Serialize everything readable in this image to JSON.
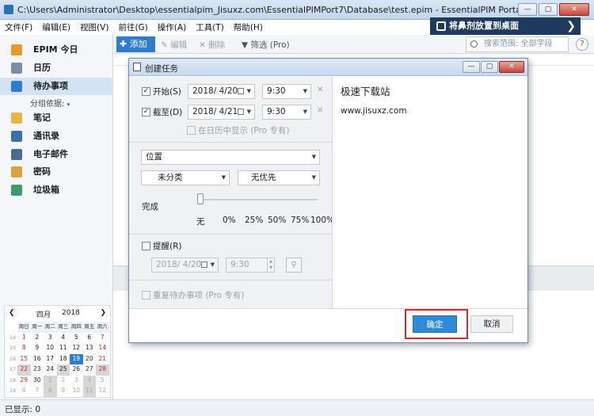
{
  "window": {
    "title": "C:\\Users\\Administrator\\Desktop\\essentialpim_Jisuxz.com\\EssentialPIMPort7\\Database\\test.epim - EssentialPIM Portable",
    "buttons": {
      "minimize": "—",
      "maximize": "▢",
      "close": "✕"
    }
  },
  "menu": [
    "文件(F)",
    "编辑(E)",
    "视图(V)",
    "前往(G)",
    "操作(A)",
    "工具(T)",
    "帮助(H)"
  ],
  "promo": {
    "label": "将鼻剂放置到桌面",
    "arrow": "❯"
  },
  "toolbar": {
    "add": "添加",
    "edit": "编辑",
    "delete": "删除",
    "filter": "筛选 (Pro)",
    "search_placeholder": "搜索范围: 全部字段",
    "help": "?"
  },
  "sidebar": {
    "items": [
      {
        "label": "EPIM 今日",
        "icon": "home-icon",
        "color": "#e79a2b"
      },
      {
        "label": "日历",
        "icon": "calendar-icon",
        "color": "#7a8ea6"
      },
      {
        "label": "待办事项",
        "icon": "clipboard-check-icon",
        "color": "#2f7ccb"
      },
      {
        "label": "笔记",
        "icon": "note-icon",
        "color": "#e6b548"
      },
      {
        "label": "通讯录",
        "icon": "contact-card-icon",
        "color": "#3e6fa8"
      },
      {
        "label": "电子邮件",
        "icon": "mail-icon",
        "color": "#4b6b90"
      },
      {
        "label": "密码",
        "icon": "key-icon",
        "color": "#d9a23b"
      },
      {
        "label": "垃圾箱",
        "icon": "trash-icon",
        "color": "#3e9a6b"
      }
    ],
    "group_by": "分组依据:"
  },
  "mini_calendar": {
    "prev": "❮",
    "next": "❯",
    "month": "四月",
    "year": "2018",
    "weekdays": [
      "周日",
      "周一",
      "周二",
      "周三",
      "周四",
      "周五",
      "周六"
    ],
    "weeks": [
      {
        "wk": "14",
        "days": [
          "1",
          "2",
          "3",
          "4",
          "5",
          "6",
          "7"
        ]
      },
      {
        "wk": "15",
        "days": [
          "8",
          "9",
          "10",
          "11",
          "12",
          "13",
          "14"
        ]
      },
      {
        "wk": "16",
        "days": [
          "15",
          "16",
          "17",
          "18",
          "19",
          "20",
          "21"
        ]
      },
      {
        "wk": "17",
        "days": [
          "22",
          "23",
          "24",
          "25",
          "26",
          "27",
          "28"
        ]
      },
      {
        "wk": "18",
        "days": [
          "29",
          "30",
          "1",
          "2",
          "3",
          "4",
          "5"
        ]
      },
      {
        "wk": "19",
        "days": [
          "6",
          "7",
          "8",
          "9",
          "10",
          "11",
          "12"
        ]
      }
    ],
    "today": "19"
  },
  "dialog": {
    "title": "创建任务",
    "start": {
      "label": "开始(S)",
      "checked": true,
      "date": "2018/ 4/20",
      "time": "9:30"
    },
    "due": {
      "label": "截至(D)",
      "checked": true,
      "date": "2018/ 4/21",
      "time": "9:30"
    },
    "show_in_calendar": "在日历中显示 (Pro 专有)",
    "location": "位置",
    "category": "未分类",
    "priority": "无优先",
    "complete_label": "完成",
    "progress_marks": [
      "无",
      "0%",
      "25%",
      "50%",
      "75%",
      "100%"
    ],
    "progress_value": 0,
    "reminder": {
      "label": "提醒(R)",
      "date": "2018/ 4/20",
      "time": "9:30"
    },
    "recurring": "重复待办事项 (Pro 专有)",
    "subject": "极速下载站",
    "notes": "www.jisuxz.com",
    "ok": "确定",
    "cancel": "取消"
  },
  "status": "已显示: 0"
}
